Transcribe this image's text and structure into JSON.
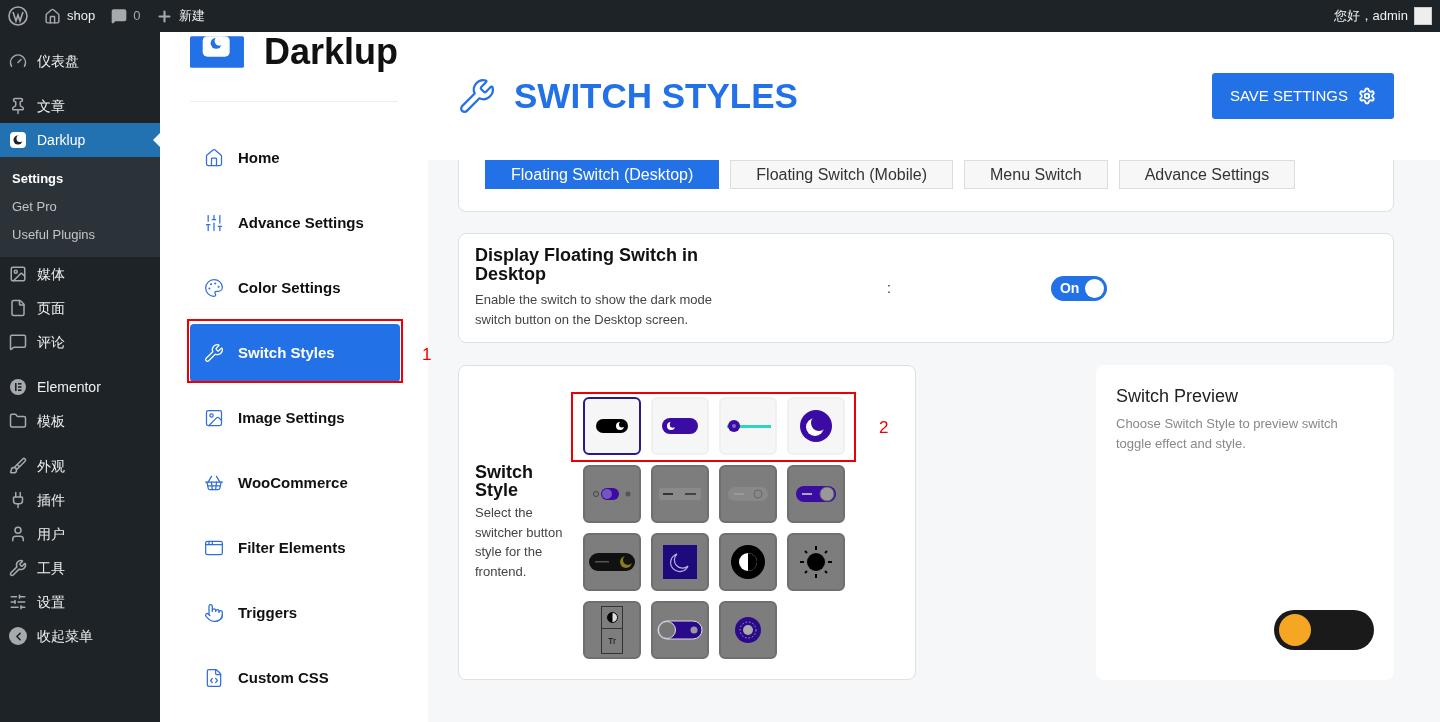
{
  "admin_bar": {
    "site": "shop",
    "comments": "0",
    "new": "新建",
    "greeting": "您好，admin"
  },
  "wp_menu": [
    {
      "items": [
        {
          "label": "仪表盘",
          "selected": false
        }
      ]
    },
    {
      "items": [
        {
          "label": "文章",
          "selected": false
        },
        {
          "label": "Darklup",
          "selected": true,
          "submenu": [
            {
              "label": "Settings",
              "selected": true
            },
            {
              "label": "Get Pro",
              "selected": false
            },
            {
              "label": "Useful Plugins",
              "selected": false
            }
          ]
        },
        {
          "label": "媒体",
          "selected": false
        },
        {
          "label": "页面",
          "selected": false
        },
        {
          "label": "评论",
          "selected": false
        }
      ]
    },
    {
      "items": [
        {
          "label": "Elementor",
          "selected": false
        },
        {
          "label": "模板",
          "selected": false
        }
      ]
    },
    {
      "items": [
        {
          "label": "外观",
          "selected": false
        },
        {
          "label": "插件",
          "selected": false
        },
        {
          "label": "用户",
          "selected": false
        },
        {
          "label": "工具",
          "selected": false
        },
        {
          "label": "设置",
          "selected": false
        },
        {
          "label": "收起菜单",
          "selected": false
        }
      ]
    }
  ],
  "plugin": {
    "logo": "Darklup",
    "nav": [
      {
        "label": "Home",
        "selected": false
      },
      {
        "label": "Advance Settings",
        "selected": false
      },
      {
        "label": "Color Settings",
        "selected": false
      },
      {
        "label": "Switch Styles",
        "selected": true,
        "annotation": "1"
      },
      {
        "label": "Image Settings",
        "selected": false
      },
      {
        "label": "WooCommerce",
        "selected": false
      },
      {
        "label": "Filter Elements",
        "selected": false
      },
      {
        "label": "Triggers",
        "selected": false
      },
      {
        "label": "Custom CSS",
        "selected": false
      }
    ]
  },
  "header": {
    "title": "SWITCH STYLES",
    "save": "SAVE SETTINGS"
  },
  "tabs": [
    {
      "label": "Floating Switch (Desktop)",
      "selected": true
    },
    {
      "label": "Floating Switch (Mobile)",
      "selected": false
    },
    {
      "label": "Menu Switch",
      "selected": false
    },
    {
      "label": "Advance Settings",
      "selected": false
    }
  ],
  "display_setting": {
    "title": "Display Floating Switch in Desktop",
    "description": "Enable the switch to show the dark mode switch button on the Desktop screen.",
    "separator": ":",
    "toggle": {
      "label": "On",
      "on": true
    }
  },
  "switch_style": {
    "title": "Switch Style",
    "description": "Select the switcher button style for the frontend.",
    "rows": [
      {
        "annotation": "2",
        "tiles": [
          {
            "kind": "pill-black",
            "selected": true,
            "disabled": false
          },
          {
            "kind": "pill-purple",
            "selected": false,
            "disabled": false
          },
          {
            "kind": "slider",
            "selected": false,
            "disabled": false
          },
          {
            "kind": "moon-circle",
            "selected": false,
            "disabled": false
          }
        ]
      },
      {
        "tiles": [
          {
            "kind": "moon-toggle",
            "selected": false,
            "disabled": true
          },
          {
            "kind": "dark-light",
            "selected": false,
            "disabled": true
          },
          {
            "kind": "light-sun",
            "selected": false,
            "disabled": true
          },
          {
            "kind": "light-sun-purple",
            "selected": false,
            "disabled": true
          }
        ]
      },
      {
        "tiles": [
          {
            "kind": "dark-pill",
            "selected": false,
            "disabled": true
          },
          {
            "kind": "moon-square",
            "selected": false,
            "disabled": true
          },
          {
            "kind": "contrast",
            "selected": false,
            "disabled": true
          },
          {
            "kind": "sun",
            "selected": false,
            "disabled": true
          }
        ]
      },
      {
        "tiles": [
          {
            "kind": "contrast-text",
            "labels": [
              "Tr"
            ],
            "selected": false,
            "disabled": true
          },
          {
            "kind": "knob-toggle",
            "selected": false,
            "disabled": true
          },
          {
            "kind": "sun-circle",
            "selected": false,
            "disabled": true
          }
        ]
      }
    ]
  },
  "preview": {
    "title": "Switch Preview",
    "description": "Choose Switch Style to preview switch toggle effect and style.",
    "toggle": {
      "on": false
    }
  }
}
